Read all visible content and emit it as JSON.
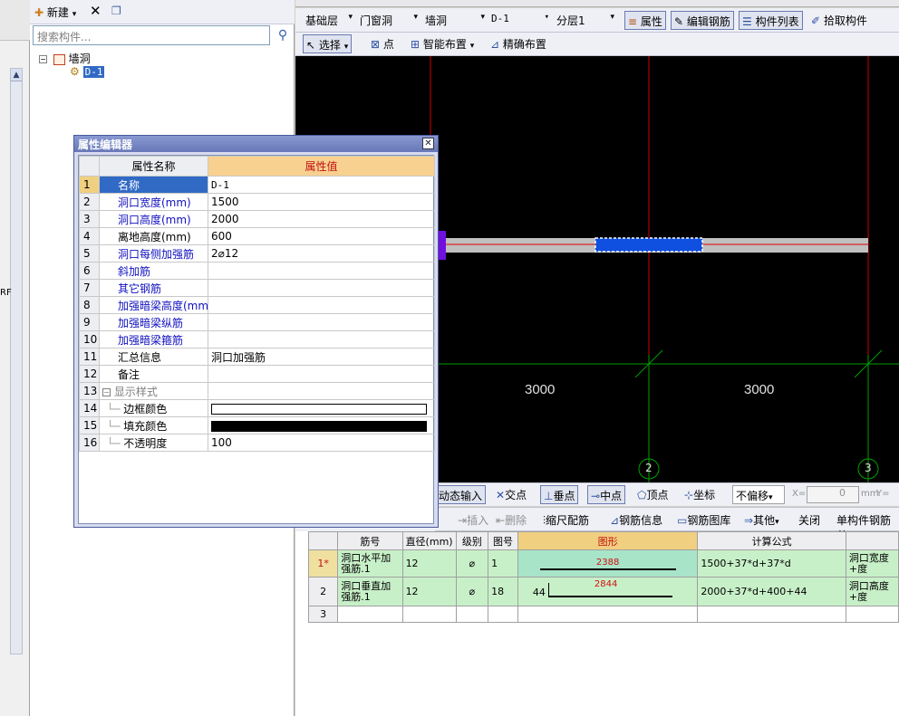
{
  "tree_toolbar": {
    "new_label": "新建",
    "delete_icon": "close-icon",
    "copy_icon": "copy-icon"
  },
  "search": {
    "placeholder": "搜索构件..."
  },
  "tree": {
    "root_label": "墙洞",
    "child_label": "D-1"
  },
  "left_edge_text": "RF",
  "toolbar1": {
    "floor": "基础层",
    "category": "门窗洞",
    "type": "墙洞",
    "component": "D-1",
    "layer": "分层1",
    "attr_btn": "属性",
    "edit_rebar_btn": "编辑钢筋",
    "comp_list_btn": "构件列表",
    "pick_btn": "拾取构件"
  },
  "toolbar2": {
    "select": "选择",
    "point": "点",
    "smart_place": "智能布置",
    "precise_place": "精确布置"
  },
  "canvas": {
    "dim_left": "3000",
    "dim_right": "3000",
    "axis_2": "2",
    "axis_3": "3"
  },
  "snapbar": {
    "dynamic_input": "动态输入",
    "intersection": "交点",
    "perpendicular": "垂点",
    "midpoint": "中点",
    "vertex": "顶点",
    "coordinate": "坐标",
    "offset": "不偏移",
    "x_label": "X=",
    "x_value": "0",
    "unit": "mm",
    "y_label": "Y="
  },
  "rebar_toolbar": {
    "insert": "插入",
    "delete": "删除",
    "scale": "缩尺配筋",
    "info": "钢筋信息",
    "library": "钢筋图库",
    "other": "其他",
    "close": "关闭",
    "summary": "单构件钢筋总"
  },
  "rebar_table": {
    "headers": [
      "筋号",
      "直径(mm)",
      "级别",
      "图号",
      "图形",
      "计算公式"
    ],
    "rows": [
      {
        "num": "1*",
        "name": "洞口水平加强筋.1",
        "dia": "12",
        "grade": "⌀",
        "fig": "1",
        "shape_val": "2388",
        "shape_pre": "",
        "formula": "1500+37*d+37*d",
        "desc": "洞口宽度+度"
      },
      {
        "num": "2",
        "name": "洞口垂直加强筋.1",
        "dia": "12",
        "grade": "⌀",
        "fig": "18",
        "shape_val": "2844",
        "shape_pre": "44",
        "formula": "2000+37*d+400+44",
        "desc": "洞口高度+度"
      },
      {
        "num": "3",
        "name": "",
        "dia": "",
        "grade": "",
        "fig": "",
        "shape_val": "",
        "shape_pre": "",
        "formula": "",
        "desc": ""
      }
    ]
  },
  "prop_editor": {
    "title": "属性编辑器",
    "header_name": "属性名称",
    "header_value": "属性值",
    "rows": [
      {
        "num": "1",
        "name": "名称",
        "value": "D-1",
        "style": "sel"
      },
      {
        "num": "2",
        "name": "洞口宽度(mm)",
        "value": "1500",
        "style": "blue"
      },
      {
        "num": "3",
        "name": "洞口高度(mm)",
        "value": "2000",
        "style": "blue"
      },
      {
        "num": "4",
        "name": "离地高度(mm)",
        "value": "600",
        "style": ""
      },
      {
        "num": "5",
        "name": "洞口每侧加强筋",
        "value": "2⌀12",
        "style": "blue"
      },
      {
        "num": "6",
        "name": "斜加筋",
        "value": "",
        "style": "blue"
      },
      {
        "num": "7",
        "name": "其它钢筋",
        "value": "",
        "style": "blue"
      },
      {
        "num": "8",
        "name": "加强暗梁高度(mm)",
        "value": "",
        "style": "blue"
      },
      {
        "num": "9",
        "name": "加强暗梁纵筋",
        "value": "",
        "style": "blue"
      },
      {
        "num": "10",
        "name": "加强暗梁箍筋",
        "value": "",
        "style": "blue"
      },
      {
        "num": "11",
        "name": "汇总信息",
        "value": "洞口加强筋",
        "style": ""
      },
      {
        "num": "12",
        "name": "备注",
        "value": "",
        "style": ""
      },
      {
        "num": "13",
        "name": "显示样式",
        "value": "",
        "style": "gray"
      },
      {
        "num": "14",
        "name": "边框颜色",
        "value": "",
        "style": ""
      },
      {
        "num": "15",
        "name": "填充颜色",
        "value": "",
        "style": ""
      },
      {
        "num": "16",
        "name": "不透明度",
        "value": "100",
        "style": ""
      }
    ],
    "border_color": "#ffffff",
    "fill_color": "#000000"
  }
}
